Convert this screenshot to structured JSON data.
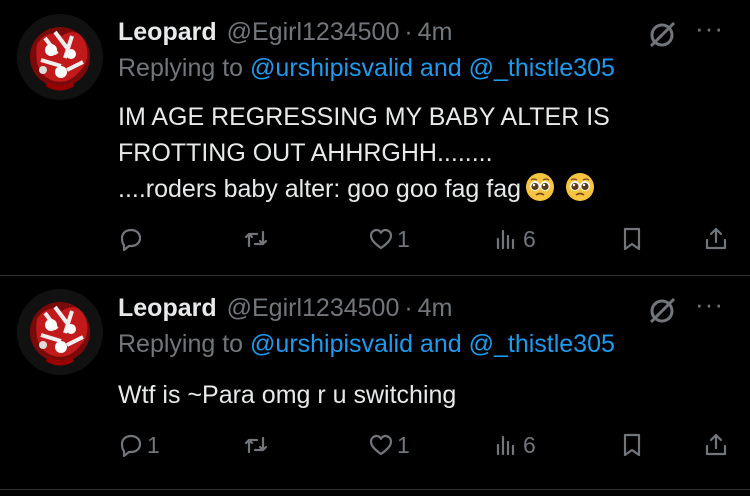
{
  "tweets": [
    {
      "author_name": "Leopard",
      "handle": "@Egirl1234500",
      "separator": "·",
      "time": "4m",
      "replying_prefix": "Replying to ",
      "replying_user1": "@urshipisvalid",
      "replying_and": " and ",
      "replying_user2": "@_thistle305",
      "text_lines": [
        "IM AGE REGRESSING MY BABY ALTER IS",
        "FROTTING OUT AHHRGHH........",
        "....roders baby alter: goo goo fag fag"
      ],
      "emojis": [
        "pleading-face",
        "pleading-face"
      ],
      "reply_count": "",
      "retweet_count": "",
      "like_count": "1",
      "view_count": "6"
    },
    {
      "author_name": "Leopard",
      "handle": "@Egirl1234500",
      "separator": "·",
      "time": "4m",
      "replying_prefix": "Replying to ",
      "replying_user1": "@urshipisvalid",
      "replying_and": " and ",
      "replying_user2": "@_thistle305",
      "text_lines": [
        "Wtf is ~Para omg r u switching"
      ],
      "reply_count": "1",
      "retweet_count": "",
      "like_count": "1",
      "view_count": "6"
    }
  ],
  "more_glyph": "···",
  "colors": {
    "background": "#000000",
    "text": "#e7e9ea",
    "secondary": "#71767b",
    "link": "#1d9bf0",
    "divider": "#2f3336"
  },
  "icons": [
    "grok-icon",
    "more-icon",
    "reply-icon",
    "retweet-icon",
    "like-icon",
    "views-icon",
    "bookmark-icon",
    "share-icon"
  ]
}
